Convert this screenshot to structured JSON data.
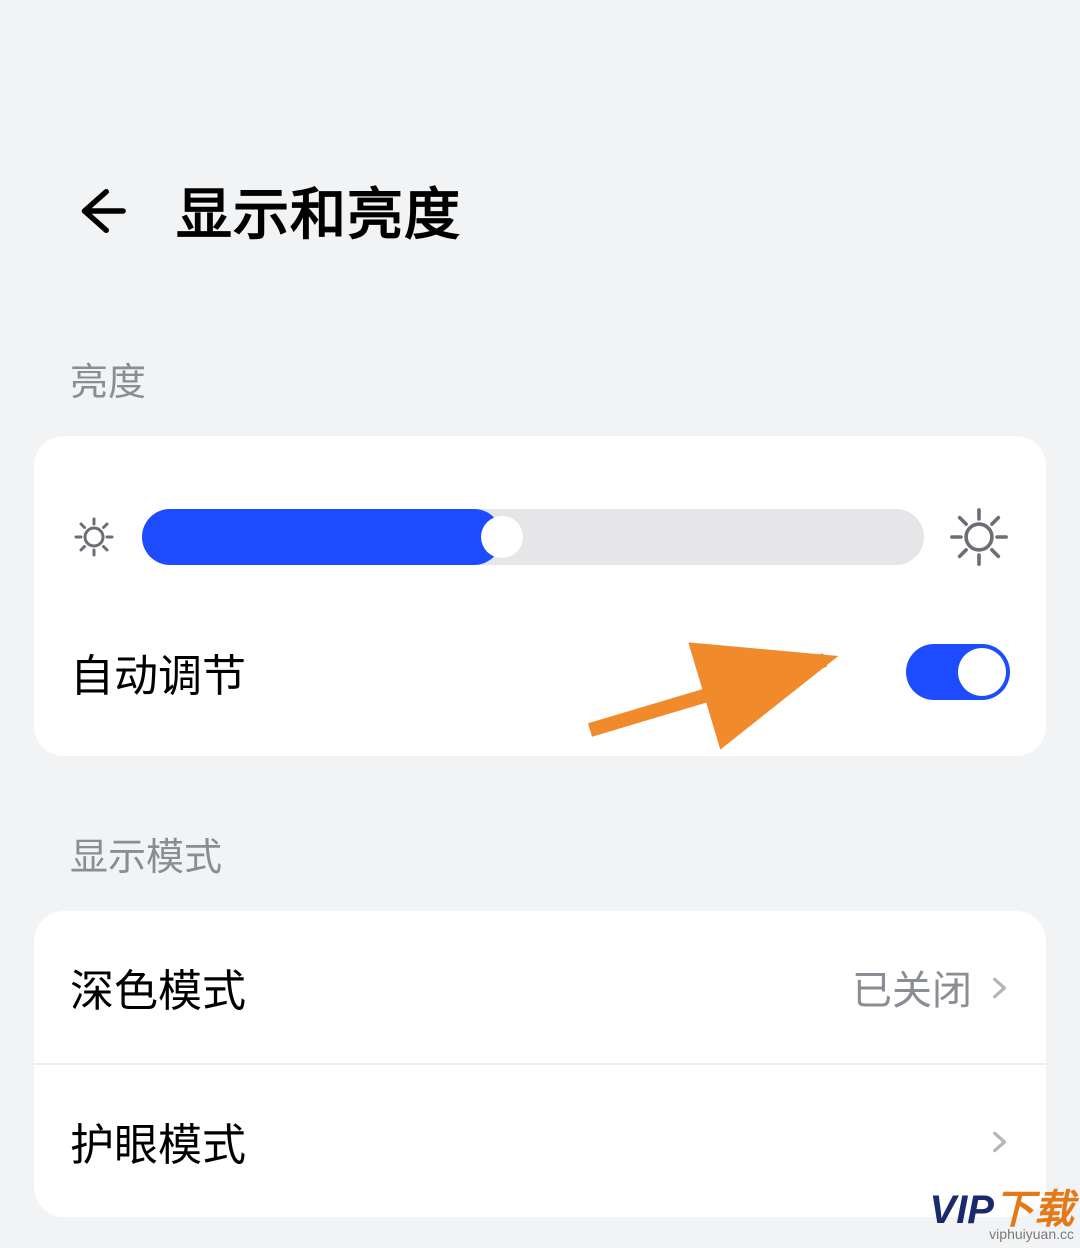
{
  "header": {
    "title": "显示和亮度"
  },
  "brightness": {
    "section_label": "亮度",
    "slider_percent": 46,
    "auto_adjust_label": "自动调节",
    "auto_adjust_on": true
  },
  "display_mode": {
    "section_label": "显示模式",
    "items": [
      {
        "label": "深色模式",
        "value": "已关闭"
      },
      {
        "label": "护眼模式",
        "value": ""
      }
    ]
  },
  "watermark": {
    "text_main_left": "VIP",
    "text_main_right": "下载",
    "sub": "viphuiyuan.cc"
  },
  "colors": {
    "accent": "#1d4cff",
    "annotation": "#f08a2a"
  }
}
